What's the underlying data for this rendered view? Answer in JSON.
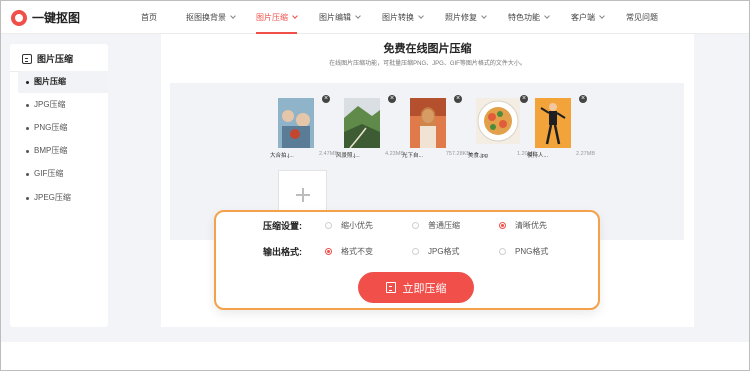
{
  "app": {
    "name": "一键抠图",
    "logo_icon": "logo-icon"
  },
  "nav": [
    {
      "label": "首页",
      "dropdown": false,
      "active": false
    },
    {
      "label": "抠图换背景",
      "dropdown": true,
      "active": false
    },
    {
      "label": "图片压缩",
      "dropdown": true,
      "active": true
    },
    {
      "label": "图片编辑",
      "dropdown": true,
      "active": false
    },
    {
      "label": "图片转换",
      "dropdown": true,
      "active": false
    },
    {
      "label": "照片修复",
      "dropdown": true,
      "active": false
    },
    {
      "label": "特色功能",
      "dropdown": true,
      "active": false
    },
    {
      "label": "客户端",
      "dropdown": true,
      "active": false
    },
    {
      "label": "常见问题",
      "dropdown": false,
      "active": false
    }
  ],
  "sidebar": {
    "title": "图片压缩",
    "items": [
      {
        "label": "图片压缩",
        "active": true
      },
      {
        "label": "JPG压缩",
        "active": false
      },
      {
        "label": "PNG压缩",
        "active": false
      },
      {
        "label": "BMP压缩",
        "active": false
      },
      {
        "label": "GIF压缩",
        "active": false
      },
      {
        "label": "JPEG压缩",
        "active": false
      }
    ]
  },
  "main": {
    "title": "免费在线图片压缩",
    "subtitle": "在线图片压缩功能，可批量压缩PNG、JPG、GIF等图片格式的文件大小。"
  },
  "files": [
    {
      "name": "大合拍.j...",
      "size": "2.47MB",
      "colors": [
        "#8fb3c9",
        "#e6c6a8",
        "#5b7c96"
      ]
    },
    {
      "name": "风景照.j...",
      "size": "4.23MB",
      "colors": [
        "#5f8a4a",
        "#d9dfe3",
        "#3d5c33"
      ]
    },
    {
      "name": "光下自...",
      "size": "757.28KB",
      "colors": [
        "#e07a4a",
        "#f3c7a2",
        "#b5502e"
      ]
    },
    {
      "name": "美食.jpg",
      "size": "1.20MB",
      "colors": [
        "#f4ede4",
        "#e25b3a",
        "#4c8b3a"
      ]
    },
    {
      "name": "模特人...",
      "size": "2.27MB",
      "colors": [
        "#f2a33a",
        "#1f1f22",
        "#f7c76a"
      ]
    }
  ],
  "settings": {
    "compress_label": "压缩设置:",
    "compress_options": [
      {
        "label": "缩小优先",
        "selected": false
      },
      {
        "label": "普通压缩",
        "selected": false
      },
      {
        "label": "清晰优先",
        "selected": true
      }
    ],
    "format_label": "输出格式:",
    "format_options": [
      {
        "label": "格式不变",
        "selected": true
      },
      {
        "label": "JPG格式",
        "selected": false
      },
      {
        "label": "PNG格式",
        "selected": false
      }
    ]
  },
  "cta": {
    "label": "立即压缩"
  },
  "colors": {
    "accent": "#f04f4a",
    "panel_border": "#f5a14a",
    "background": "#f3f4f8"
  }
}
